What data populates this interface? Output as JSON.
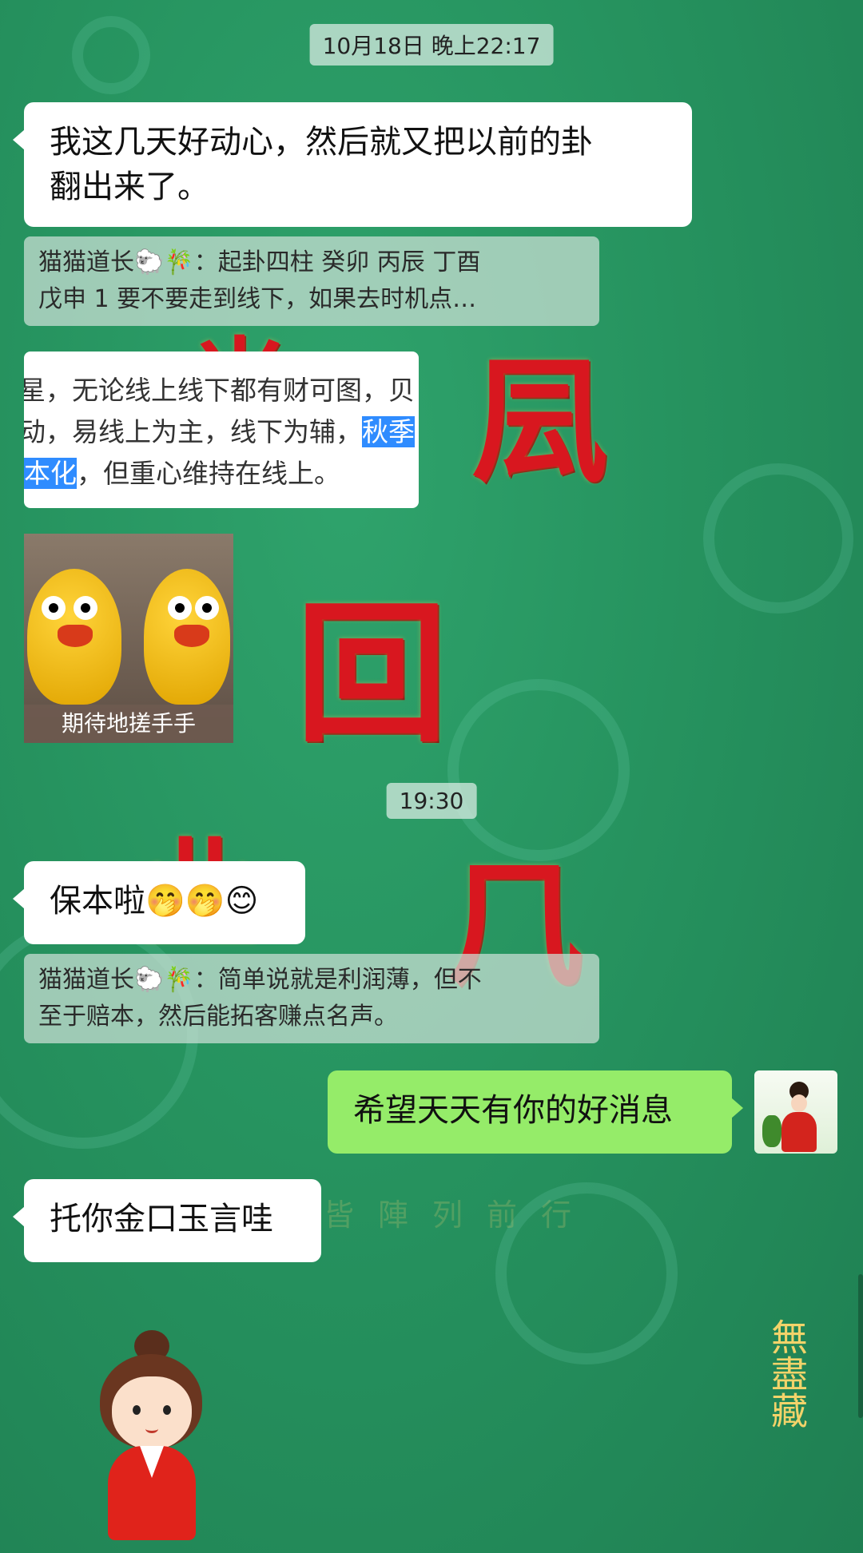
{
  "timestamps": {
    "first": "10月18日 晚上22:17",
    "second": "19:30"
  },
  "messages": {
    "m1": {
      "line1": "我这几天好动心，然后就又把以前的卦",
      "line2": "翻出来了。"
    },
    "quote1": {
      "line1_prefix": "猫猫道长🐑🎋：起卦四柱 癸卯 丙辰 丁酉",
      "line2": "戊申  1 要不要走到线下，如果去时机点…"
    },
    "image_card": {
      "line1": "星，无论线上线下都有财可图，贝",
      "line2_normal": "动，易线上为主，线下为辅，",
      "line2_highlight": "秋季",
      "line3_highlight": "本化",
      "line3_normal": "，但重心维持在线上。"
    },
    "sticker": {
      "caption": "期待地搓手手"
    },
    "m2": {
      "text": "保本啦🤭🤭😊"
    },
    "quote2": {
      "line1": "猫猫道长🐑🎋：简单说就是利润薄，但不",
      "line2": "至于赔本，然后能拓客赚点名声。"
    },
    "m3": {
      "text": "希望天天有你的好消息"
    },
    "m4": {
      "text": "托你金口玉言哇"
    }
  },
  "background": {
    "faint_text": "皆陣列前行",
    "vertical_text": "無盡藏"
  },
  "colors": {
    "background_green": "#26935f",
    "bubble_self": "#95ec69",
    "bubble_other": "#ffffff",
    "highlight_blue": "#2f8cff"
  }
}
